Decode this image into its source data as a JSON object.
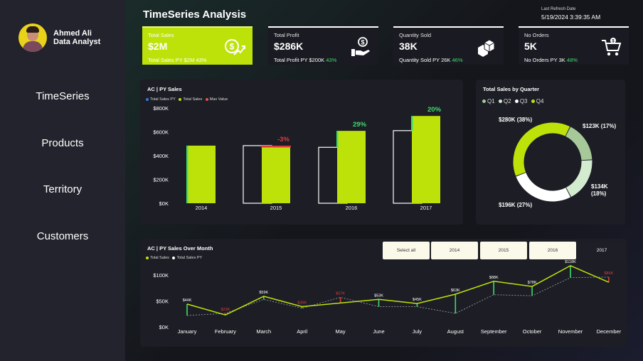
{
  "profile": {
    "name": "Ahmed Ali",
    "role": "Data Analyst"
  },
  "nav": [
    "TimeSeries",
    "Products",
    "Territory",
    "Customers"
  ],
  "header": {
    "title": "TimeSeries Analysis",
    "refresh_label": "Last Refresh Date",
    "refresh_time": "5/19/2024 3:39:35 AM"
  },
  "kpis": [
    {
      "label": "Total Sales",
      "value": "$2M",
      "py_text": "Total Sales PY $2M",
      "pct": "43%",
      "icon": "money-growth-icon"
    },
    {
      "label": "Total Profit",
      "value": "$286K",
      "py_text": "Total Profit PY $200K",
      "pct": "43%",
      "icon": "money-hand-icon"
    },
    {
      "label": "Quantity Sold",
      "value": "38K",
      "py_text": "Quantity Sold PY 26K",
      "pct": "46%",
      "icon": "boxes-icon"
    },
    {
      "label": "No Orders",
      "value": "5K",
      "py_text": "No Orders PY 3K",
      "pct": "48%",
      "icon": "cart-icon"
    }
  ],
  "colors": {
    "accent": "#bde20a",
    "positive": "#3fdc6c",
    "negative": "#e03b3b",
    "py": "#ffffff"
  },
  "slicer": {
    "options": [
      "Select all",
      "2014",
      "2015",
      "2016",
      "2017"
    ],
    "selected": "2017"
  },
  "chart_data": [
    {
      "type": "bar",
      "title": "AC | PY Sales",
      "legend": [
        "Total Sales PY",
        "Total Sales",
        "Max Value"
      ],
      "categories": [
        "2014",
        "2015",
        "2016",
        "2017"
      ],
      "series": [
        {
          "name": "Total Sales PY",
          "values": [
            0,
            484000,
            470000,
            610000
          ]
        },
        {
          "name": "Total Sales",
          "values": [
            484000,
            470000,
            608000,
            733000
          ]
        }
      ],
      "data_labels": [
        "",
        "-3%",
        "29%",
        "20%"
      ],
      "ylim": [
        0,
        800000
      ],
      "yticks": [
        "$0K",
        "$200K",
        "$400K",
        "$600K",
        "$800K"
      ]
    },
    {
      "type": "pie",
      "title": "Total Sales by Quarter",
      "legend": [
        "Q1",
        "Q2",
        "Q3",
        "Q4"
      ],
      "categories": [
        "Q1",
        "Q2",
        "Q3",
        "Q4"
      ],
      "values": [
        123000,
        134000,
        196000,
        280000
      ],
      "labels": [
        "$123K (17%)",
        "$134K (18%)",
        "$196K (27%)",
        "$280K (38%)"
      ],
      "colors": [
        "#a7c99a",
        "#d3ecd0",
        "#ffffff",
        "#bde20a"
      ]
    },
    {
      "type": "line",
      "title": "AC | PY Sales Over Month",
      "legend": [
        "Total Sales",
        "Total Sales PY"
      ],
      "categories": [
        "January",
        "February",
        "March",
        "April",
        "May",
        "June",
        "July",
        "August",
        "September",
        "October",
        "November",
        "December"
      ],
      "series": [
        {
          "name": "Total Sales",
          "values": [
            44000,
            23000,
            59000,
            39000,
            46000,
            53000,
            45000,
            63000,
            88000,
            78000,
            118000,
            86000
          ]
        },
        {
          "name": "Total Sales PY",
          "values": [
            22000,
            26000,
            53000,
            36000,
            57000,
            39000,
            39000,
            26000,
            62000,
            60000,
            95000,
            96000
          ]
        }
      ],
      "data_labels": [
        "$44K",
        "$23K",
        "$59K",
        "$39K",
        "$57K",
        "$53K",
        "$45K",
        "$63K",
        "$88K",
        "$78K",
        "$118K",
        "$86K"
      ],
      "label_colors": [
        "#ffffff",
        "#e03b3b",
        "#ffffff",
        "#e03b3b",
        "#e03b3b",
        "#ffffff",
        "#ffffff",
        "#ffffff",
        "#ffffff",
        "#ffffff",
        "#ffffff",
        "#e03b3b"
      ],
      "ylim": [
        0,
        120000
      ],
      "yticks": [
        "$0K",
        "$50K",
        "$100K"
      ]
    }
  ]
}
